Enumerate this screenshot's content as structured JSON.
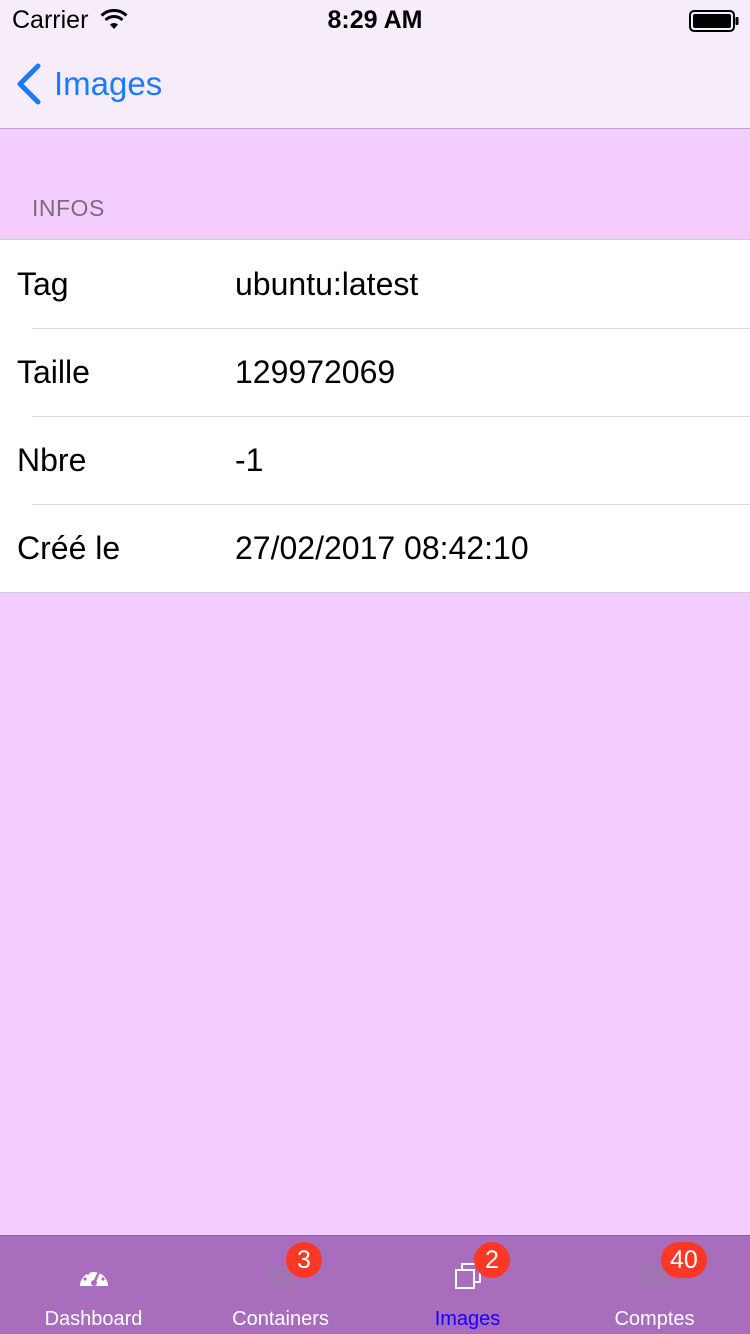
{
  "status_bar": {
    "carrier": "Carrier",
    "time": "8:29 AM"
  },
  "nav": {
    "back_label": "Images"
  },
  "section": {
    "header": "INFOS"
  },
  "info_rows": [
    {
      "key": "Tag",
      "value": "ubuntu:latest"
    },
    {
      "key": "Taille",
      "value": "129972069"
    },
    {
      "key": "Nbre",
      "value": "-1"
    },
    {
      "key": "Créé le",
      "value": "27/02/2017 08:42:10"
    }
  ],
  "tab_bar": {
    "items": [
      {
        "label": "Dashboard",
        "icon": "dashboard-gauge-icon",
        "badge": ""
      },
      {
        "label": "Containers",
        "icon": "list-icon",
        "badge": "3"
      },
      {
        "label": "Images",
        "icon": "images-stack-icon",
        "badge": "2"
      },
      {
        "label": "Comptes",
        "icon": "list-icon",
        "badge": "40"
      }
    ],
    "active_index": 2
  },
  "colors": {
    "background": "#f3cdfd",
    "tab_bar": "#a86dbd",
    "accent": "#1a7cf6",
    "badge": "#fb3826",
    "active_tab": "#1500ff"
  }
}
